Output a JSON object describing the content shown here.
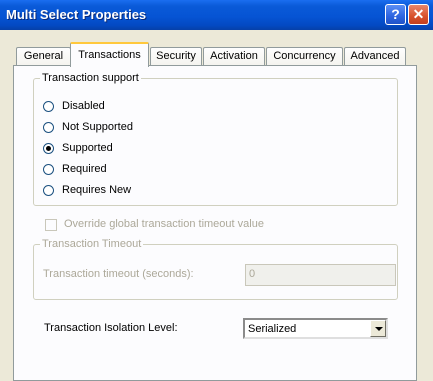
{
  "window": {
    "title": "Multi Select Properties",
    "help_glyph": "?",
    "close_glyph": "✕"
  },
  "tabs": [
    {
      "label": "General",
      "active": false
    },
    {
      "label": "Transactions",
      "active": true
    },
    {
      "label": "Security",
      "active": false
    },
    {
      "label": "Activation",
      "active": false
    },
    {
      "label": "Concurrency",
      "active": false
    },
    {
      "label": "Advanced",
      "active": false
    }
  ],
  "transaction_support": {
    "legend": "Transaction support",
    "options": [
      {
        "label": "Disabled",
        "checked": false
      },
      {
        "label": "Not Supported",
        "checked": false
      },
      {
        "label": "Supported",
        "checked": true
      },
      {
        "label": "Required",
        "checked": false
      },
      {
        "label": "Requires New",
        "checked": false
      }
    ]
  },
  "override": {
    "label": "Override global transaction timeout value",
    "checked": false
  },
  "timeout": {
    "legend": "Transaction Timeout",
    "label": "Transaction timeout (seconds):",
    "value": "0"
  },
  "isolation": {
    "label": "Transaction Isolation Level:",
    "selected": "Serialized"
  }
}
